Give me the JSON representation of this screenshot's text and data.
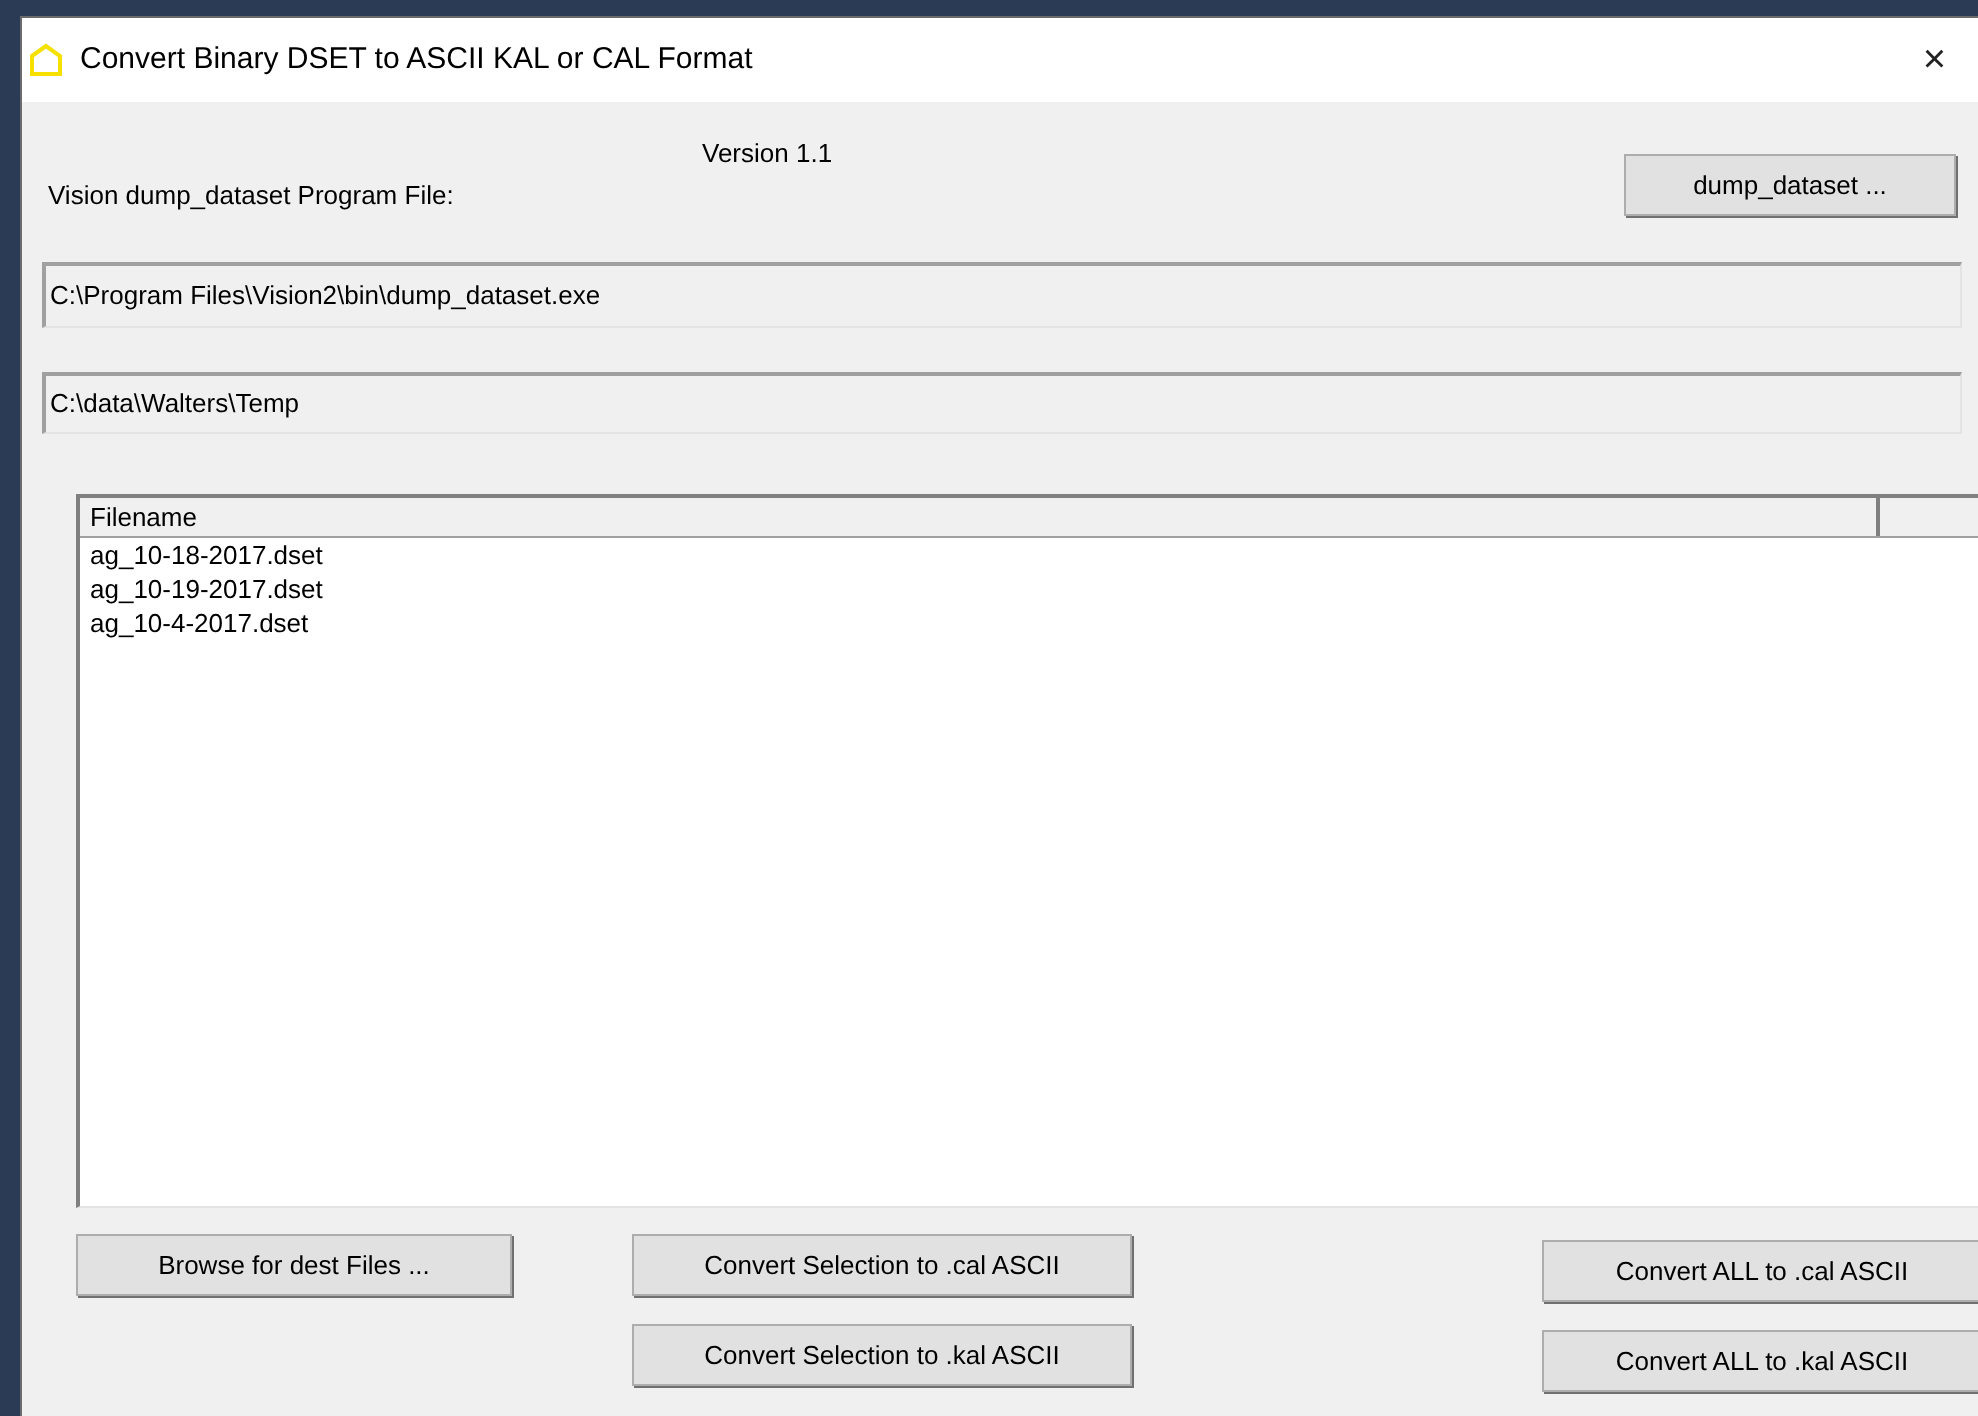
{
  "window": {
    "title": "Convert Binary DSET to ASCII KAL or CAL Format",
    "close": "×"
  },
  "version": "Version 1.1",
  "program_label": "Vision dump_dataset Program File:",
  "dump_button": "dump_dataset ...",
  "program_path": "C:\\Program Files\\Vision2\\bin\\dump_dataset.exe",
  "dest_path": "C:\\data\\Walters\\Temp",
  "file_list": {
    "columns": [
      "Filename"
    ],
    "rows": [
      {
        "name": "ag_10-18-2017.dset",
        "selected": false
      },
      {
        "name": "ag_10-19-2017.dset",
        "selected": false
      },
      {
        "name": "ag_10-4-2017.dset",
        "selected": false
      }
    ]
  },
  "buttons": {
    "browse": "Browse for dest Files ...",
    "sel_cal": "Convert Selection to .cal ASCII",
    "sel_kal": "Convert Selection to .kal ASCII",
    "all_cal": "Convert ALL to .cal ASCII",
    "all_kal": "Convert ALL to .kal ASCII"
  }
}
